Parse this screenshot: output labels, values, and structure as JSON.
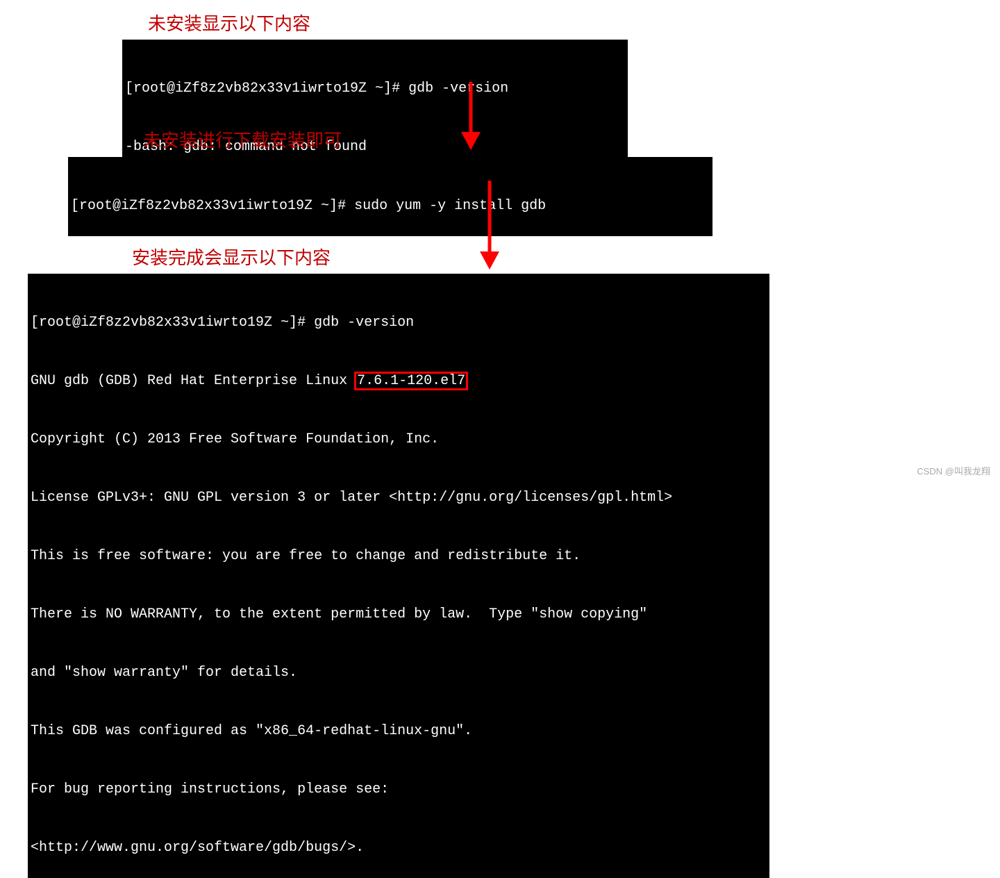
{
  "annotations": {
    "not_installed": "未安装显示以下内容",
    "install_cmd": "未安装进行下载安装即可",
    "installed": "安装完成会显示以下内容"
  },
  "terminals": {
    "t1": {
      "line1": "[root@iZf8z2vb82x33v1iwrto19Z ~]# gdb -version",
      "line2": "-bash: gdb: command not found"
    },
    "t2": {
      "line1": "[root@iZf8z2vb82x33v1iwrto19Z ~]# sudo yum -y install gdb"
    },
    "t3": {
      "line1": "[root@iZf8z2vb82x33v1iwrto19Z ~]# gdb -version",
      "line2a": "GNU gdb (GDB) Red Hat Enterprise Linux ",
      "line2b_highlight": "7.6.1-120.el7",
      "line3": "Copyright (C) 2013 Free Software Foundation, Inc.",
      "line4": "License GPLv3+: GNU GPL version 3 or later <http://gnu.org/licenses/gpl.html>",
      "line5": "This is free software: you are free to change and redistribute it.",
      "line6": "There is NO WARRANTY, to the extent permitted by law.  Type \"show copying\"",
      "line7": "and \"show warranty\" for details.",
      "line8": "This GDB was configured as \"x86_64-redhat-linux-gnu\".",
      "line9": "For bug reporting instructions, please see:",
      "line10": "<http://www.gnu.org/software/gdb/bugs/>."
    }
  },
  "watermark": "CSDN @叫我龙翔"
}
